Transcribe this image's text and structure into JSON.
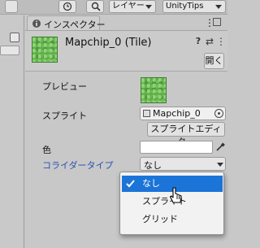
{
  "toolbar": {
    "layers_label": "レイヤー",
    "layout_label": "UnityTips"
  },
  "inspector": {
    "tab_label": "インスペクター",
    "object_title": "Mapchip_0 (Tile)",
    "open_button": "開く",
    "fields": {
      "preview_label": "プレビュー",
      "sprite_label": "スプライト",
      "sprite_value": "Mapchip_0",
      "sprite_editor_button": "スプライトエディター",
      "color_label": "色",
      "collider_label": "コライダータイプ",
      "collider_value": "なし"
    },
    "collider_options": [
      "なし",
      "スプライト",
      "グリッド"
    ],
    "selected_option": "なし"
  },
  "colors": {
    "accent": "#1b74d8",
    "collider_label": "#2d4fb4",
    "grass": "#5fae46"
  }
}
